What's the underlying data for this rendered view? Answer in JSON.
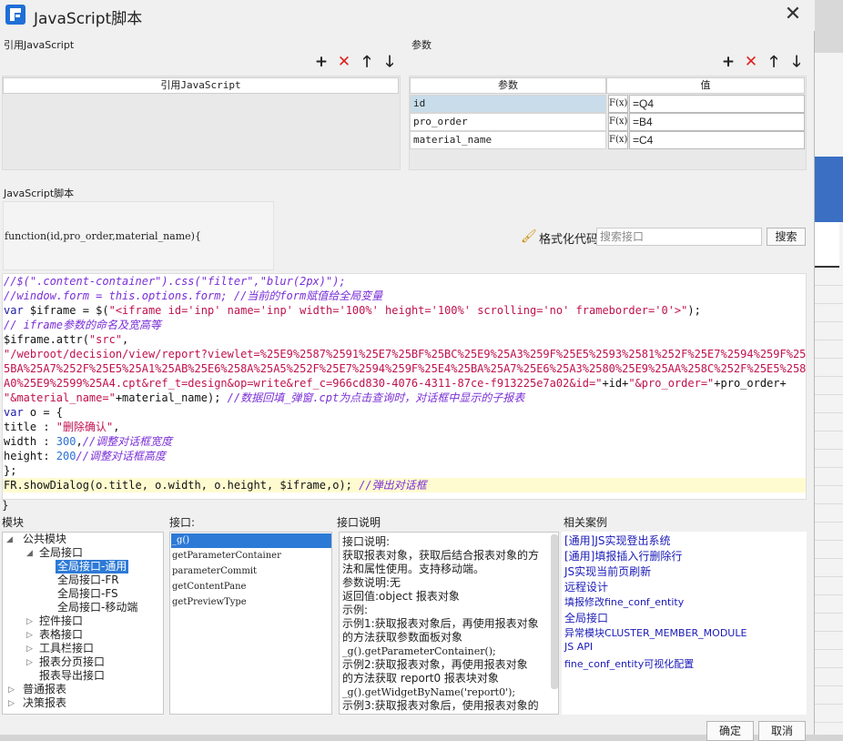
{
  "window": {
    "title": "JavaScript脚本",
    "close": "✕"
  },
  "ref_js": {
    "label": "引用JavaScript",
    "header": "引用JavaScript"
  },
  "params": {
    "label": "参数",
    "col_name": "参数",
    "col_value": "值",
    "fx": "F(x)",
    "rows": [
      {
        "name": "id",
        "value": "=Q4"
      },
      {
        "name": "pro_order",
        "value": "=B4"
      },
      {
        "name": "material_name",
        "value": "=C4"
      }
    ]
  },
  "toolbar": {
    "add": "+",
    "delete": "✕",
    "up": "🡑",
    "down": "🡓"
  },
  "script": {
    "label": "JavaScript脚本",
    "signature": "function(id,pro_order,material_name){",
    "format_label": "格式化代码",
    "search_placeholder": "搜索接口",
    "search_button": "搜索",
    "closing_brace": "}",
    "lines": {
      "l1": "//$(\".content-container\").css(\"filter\",\"blur(2px)\");",
      "l2": "//window.form = this.options.form; //当前的form赋值给全局变量",
      "l3a": "var",
      "l3b": " $iframe = $(",
      "l3c": "\"<iframe id='inp' name='inp' width='100%' height='100%' scrolling='no' frameborder='0'>\"",
      "l3d": ");",
      "l4": "// iframe参数的命名及宽高等",
      "l5a": "$iframe.attr(",
      "l5b": "\"src\"",
      "l5c": ",",
      "l6": "\"/webroot/decision/view/report?viewlet=%25E9%2587%2591%25E7%25BF%25BC%25E9%25A3%259F%25E5%2593%2581%252F%25E7%2594%259F%25E4%2",
      "l7": "5BA%25A7%252F%25E5%25A1%25AB%25E6%258A%25A5%252F%25E7%2594%259F%25E4%25BA%25A7%25E6%25A3%2580%25E9%25AA%258C%252F%25E5%2588%25",
      "l8a": "A0%25E9%2599%25A4.cpt&ref_t=design&op=write&ref_c=966cd830-4076-4311-87ce-f913225e7a02&id=\"",
      "l8b": "+id+",
      "l8c": "\"&pro_order=\"",
      "l8d": "+pro_order+",
      "l9a": "\"&material_name=\"",
      "l9b": "+material_name); ",
      "l9c": "//数据回填_弹窗.cpt为点击查询时，对话框中显示的子报表",
      "l10a": "var",
      "l10b": " o = {",
      "l11a": "title : ",
      "l11b": "\"删除确认\"",
      "l11c": ",",
      "l12a": "width : ",
      "l12b": "300",
      "l12c": ",",
      "l12d": "//调整对话框宽度",
      "l13a": "height: ",
      "l13b": "200",
      "l13c": "//调整对话框高度",
      "l14": "};",
      "l15a": "FR.showDialog(o.title, o.width, o.height, $iframe,o); ",
      "l15b": "//弹出对话框"
    }
  },
  "modules": {
    "label": "模块",
    "tree": [
      {
        "label": "公共模块"
      },
      {
        "label": "全局接口"
      },
      {
        "label": "全局接口-通用"
      },
      {
        "label": "全局接口-FR"
      },
      {
        "label": "全局接口-FS"
      },
      {
        "label": "全局接口-移动端"
      },
      {
        "label": "控件接口"
      },
      {
        "label": "表格接口"
      },
      {
        "label": "工具栏接口"
      },
      {
        "label": "报表分页接口"
      },
      {
        "label": "报表导出接口"
      },
      {
        "label": "普通报表"
      },
      {
        "label": "决策报表"
      }
    ]
  },
  "interfaces": {
    "label": "接口:",
    "items": [
      "_g()",
      "getParameterContainer",
      "parameterCommit",
      "getContentPane",
      "getPreviewType"
    ]
  },
  "description": {
    "label": "接口说明",
    "lines": [
      "接口说明:",
      "获取报表对象，获取后结合报表对象的方",
      "法和属性使用。支持移动端。",
      "参数说明:无",
      "返回值:object 报表对象",
      "示例:",
      "示例1:获取报表对象后，再使用报表对象",
      "的方法获取参数面板对象",
      "_g().getParameterContainer();",
      "示例2:获取报表对象，再使用报表对象",
      "的方法获取 report0 报表块对象",
      "_g().getWidgetByName('report0');",
      "示例3:获取报表对象后，使用报表对象的"
    ]
  },
  "cases": {
    "label": "相关案例",
    "items": [
      "[通用]JS实现登出系统",
      "[通用]填报插入行删除行",
      "JS实现当前页刷新",
      "远程设计",
      "填报修改fine_conf_entity",
      "全局接口",
      "异常模块CLUSTER_MEMBER_MODULE",
      "JS API",
      "fine_conf_entity可视化配置"
    ]
  },
  "footer": {
    "ok": "确定",
    "cancel": "取消"
  }
}
